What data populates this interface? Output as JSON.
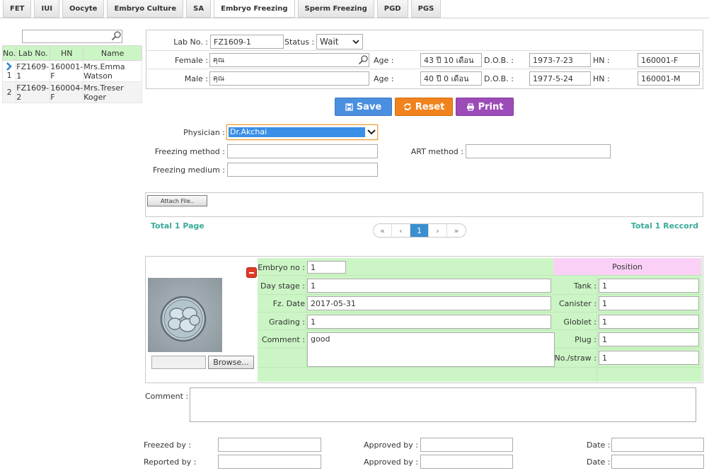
{
  "tabs": [
    "FET",
    "IUI",
    "Oocyte",
    "Embryo Culture",
    "SA",
    "Embryo Freezing",
    "Sperm Freezing",
    "PGD",
    "PGS"
  ],
  "active_tab": 5,
  "list": {
    "headers": {
      "no": "No.",
      "lab": "Lab No.",
      "hn": "HN",
      "name": "Name"
    },
    "rows": [
      {
        "no": "1",
        "lab": "FZ1609-1",
        "hn": "160001-F",
        "name": "Mrs.Emma Watson"
      },
      {
        "no": "2",
        "lab": "FZ1609-2",
        "hn": "160004-F",
        "name": "Mrs.Treser Koger"
      }
    ]
  },
  "patient": {
    "lab_label": "Lab No. :",
    "lab_value": "FZ1609-1",
    "status_label": "Status :",
    "status_value": "Wait",
    "female_label": "Female :",
    "female_value": "คุณ",
    "male_label": "Male :",
    "male_value": "คุณ",
    "age_label": "Age :",
    "female_age": "43 ปี 10 เดือน",
    "male_age": "40 ปี 0 เดือน",
    "dob_label": "D.O.B. :",
    "female_dob": "1973-7-23",
    "male_dob": "1977-5-24",
    "hn_label": "HN :",
    "female_hn": "160001-F",
    "male_hn": "160001-M"
  },
  "buttons": {
    "save": "Save",
    "reset": "Reset",
    "print": "Print"
  },
  "form": {
    "physician_label": "Physician :",
    "physician_value": "Dr.Akchai",
    "method_label": "Freezing method :",
    "art_label": "ART method :",
    "medium_label": "Freezing medium :"
  },
  "attach": {
    "button": "Attach File..",
    "total_page": "Total 1 Page",
    "total_record": "Total 1 Reccord",
    "pager": [
      "«",
      "‹",
      "1",
      "›",
      "»"
    ]
  },
  "embryo": {
    "no_label": "Embryo no :",
    "no_value": "1",
    "day_label": "Day stage :",
    "day_value": "1",
    "date_label": "Fz. Date",
    "date_value": "2017-05-31",
    "grading_label": "Grading :",
    "grading_value": "1",
    "comment_label": "Comment :",
    "comment_value": "good",
    "browse": "Browse...",
    "position_label": "Position",
    "tank_label": "Tank :",
    "tank_value": "1",
    "canister_label": "Canister :",
    "canister_value": "1",
    "goblet_label": "Globlet :",
    "goblet_value": "1",
    "plug_label": "Plug :",
    "plug_value": "1",
    "straw_label": "No./straw :",
    "straw_value": "1"
  },
  "footer": {
    "comment_label": "Comment :",
    "freezed_label": "Freezed by :",
    "reported_label": "Reported by :",
    "approved_label": "Approved by :",
    "date_label": "Date :"
  },
  "colors": {
    "green": "#ccf5c5",
    "pink": "#fad0f7",
    "save": "#4a8fe0",
    "reset": "#f0831e",
    "print": "#9c4bb8"
  }
}
